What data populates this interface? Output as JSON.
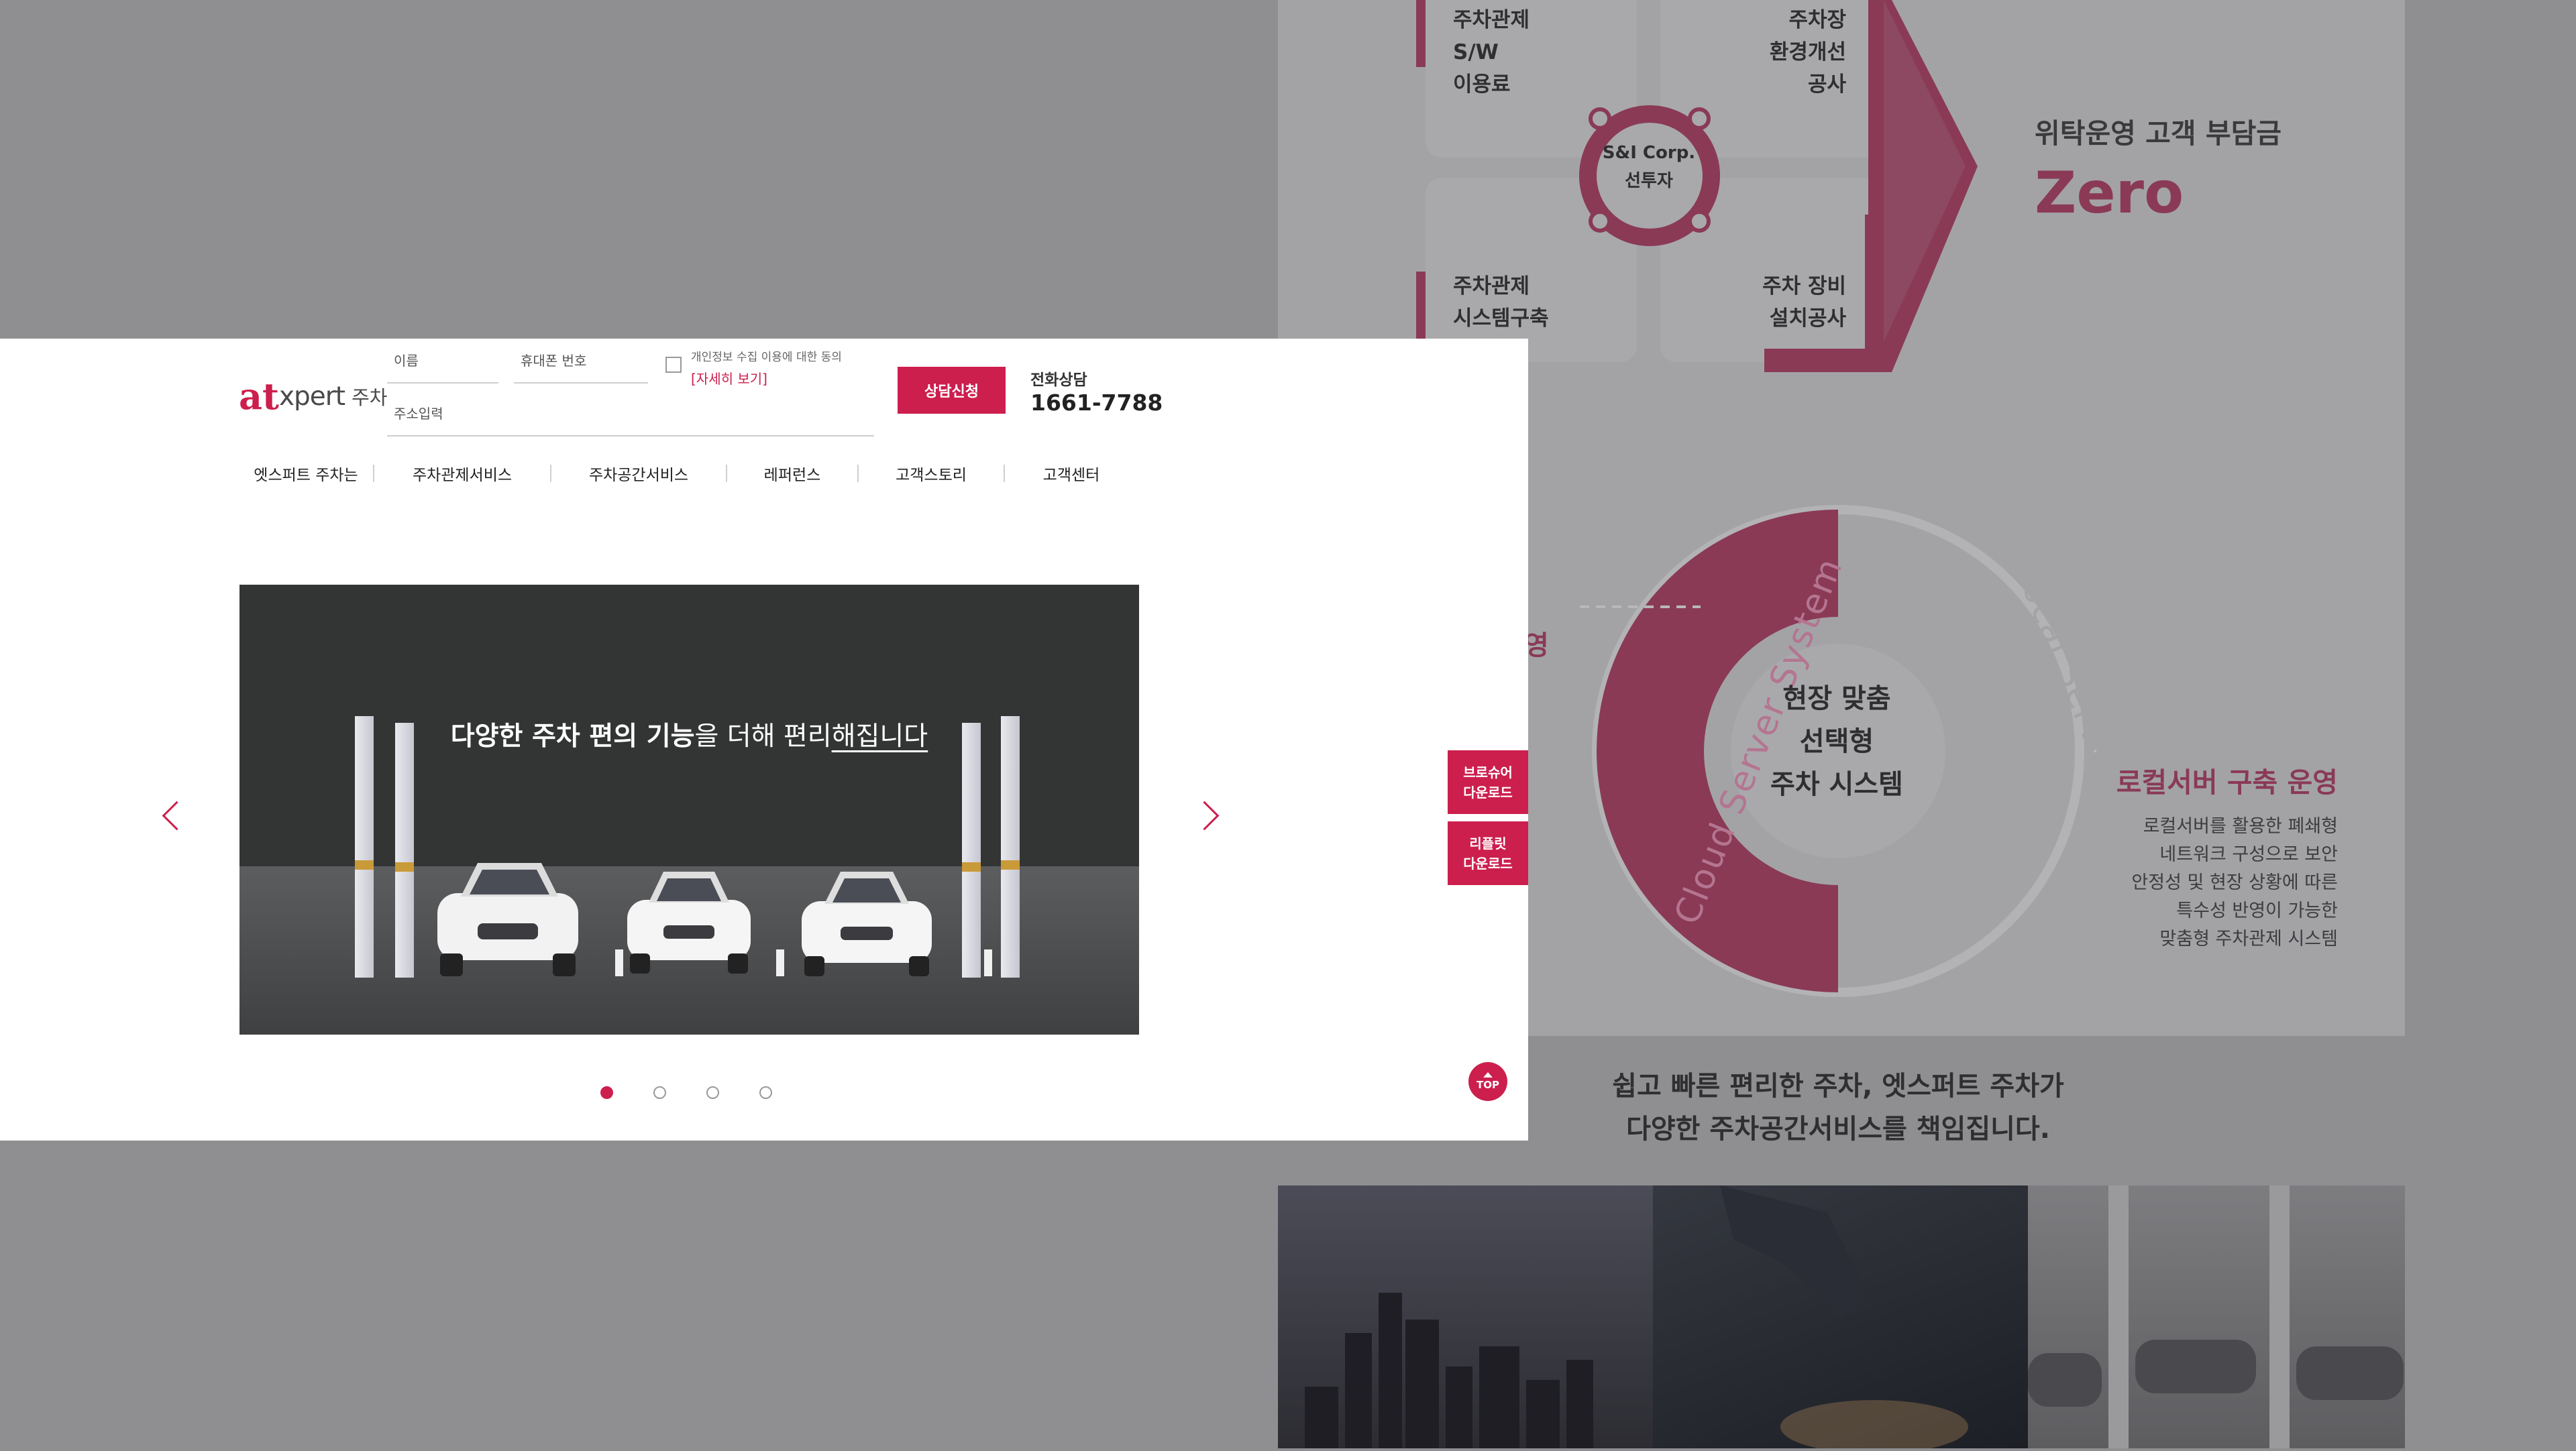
{
  "background": {
    "diagram_cells": {
      "top_left": [
        "주차관제",
        "S/W",
        "이용료"
      ],
      "top_right": [
        "주차장",
        "환경개선",
        "공사"
      ],
      "bottom_left": [
        "주차관제",
        "시스템구축"
      ],
      "bottom_right": [
        "주차 장비",
        "설치공사"
      ],
      "center": [
        "S&I Corp.",
        "선투자"
      ]
    },
    "zero_subtitle": "위탁운영 고객 부담금",
    "zero_title": "Zero",
    "server_center": [
      "현장 맞춤",
      "선택형",
      "주차 시스템"
    ],
    "cloud_label": "Cloud Server System",
    "local_label": "Local Server System",
    "left_fragment": "영",
    "local_title": "로컬서버 구축 운영",
    "local_desc": [
      "로컬서버를 활용한 폐쇄형",
      "네트워크 구성으로 보안",
      "안정성 및 현장 상황에 따른",
      "특수성 반영이 가능한",
      "맞춤형 주차관제 시스템"
    ],
    "tagline": [
      "쉽고 빠른 편리한 주차, 엣스퍼트 주차가",
      "다양한 주차공간서비스를 책임집니다."
    ]
  },
  "header": {
    "logo_mark": "at",
    "logo_word": "xpert",
    "logo_ko": "주차",
    "name_placeholder": "이름",
    "phone_placeholder": "휴대폰 번호",
    "address_placeholder": "주소입력",
    "agree_text": "개인정보 수집 이용에 대한 동의",
    "agree_link": "[자세히 보기]",
    "submit_label": "상담신청",
    "tel_label": "전화상담",
    "tel_number": "1661-7788"
  },
  "nav": [
    "엣스퍼트 주차는",
    "주차관제서비스",
    "주차공간서비스",
    "레퍼런스",
    "고객스토리",
    "고객센터"
  ],
  "slide": {
    "title_bold": "다양한 주차 편의 기능",
    "title_mid": "을 더해 편리",
    "title_underline": "해집니다"
  },
  "side_buttons": {
    "brochure": [
      "브로슈어",
      "다운로드"
    ],
    "leaflet": [
      "리플릿",
      "다운로드"
    ],
    "top": "TOP"
  },
  "colors": {
    "accent": "#cc1f4d",
    "dim_accent": "#8a3a55"
  }
}
